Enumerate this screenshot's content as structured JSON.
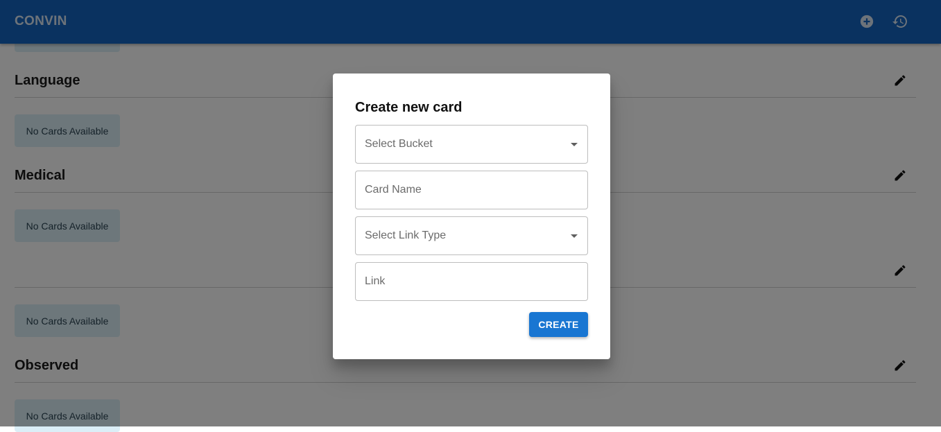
{
  "app": {
    "brand": "CONVIN",
    "actions": [
      {
        "icon": "add-circle-icon"
      },
      {
        "icon": "history-icon"
      }
    ]
  },
  "sections": [
    {
      "title": "Language",
      "empty_label": "No Cards Available"
    },
    {
      "title": "Medical",
      "empty_label": "No Cards Available"
    },
    {
      "title": "",
      "empty_label": "No Cards Available"
    },
    {
      "title": "Observed",
      "empty_label": "No Cards Available"
    }
  ],
  "top_chip": {
    "label": ""
  },
  "modal": {
    "title": "Create new card",
    "fields": {
      "bucket": {
        "placeholder": "Select Bucket",
        "value": ""
      },
      "card_name": {
        "placeholder": "Card Name",
        "value": ""
      },
      "link_type": {
        "placeholder": "Select Link Type",
        "value": ""
      },
      "link": {
        "placeholder": "Link",
        "value": ""
      }
    },
    "create_label": "CREATE"
  },
  "colors": {
    "appbar": "#1565c0",
    "primary_button": "#1976d2",
    "chip_bg": "#dbeef7",
    "overlay": "rgba(0,0,0,0.5)"
  }
}
